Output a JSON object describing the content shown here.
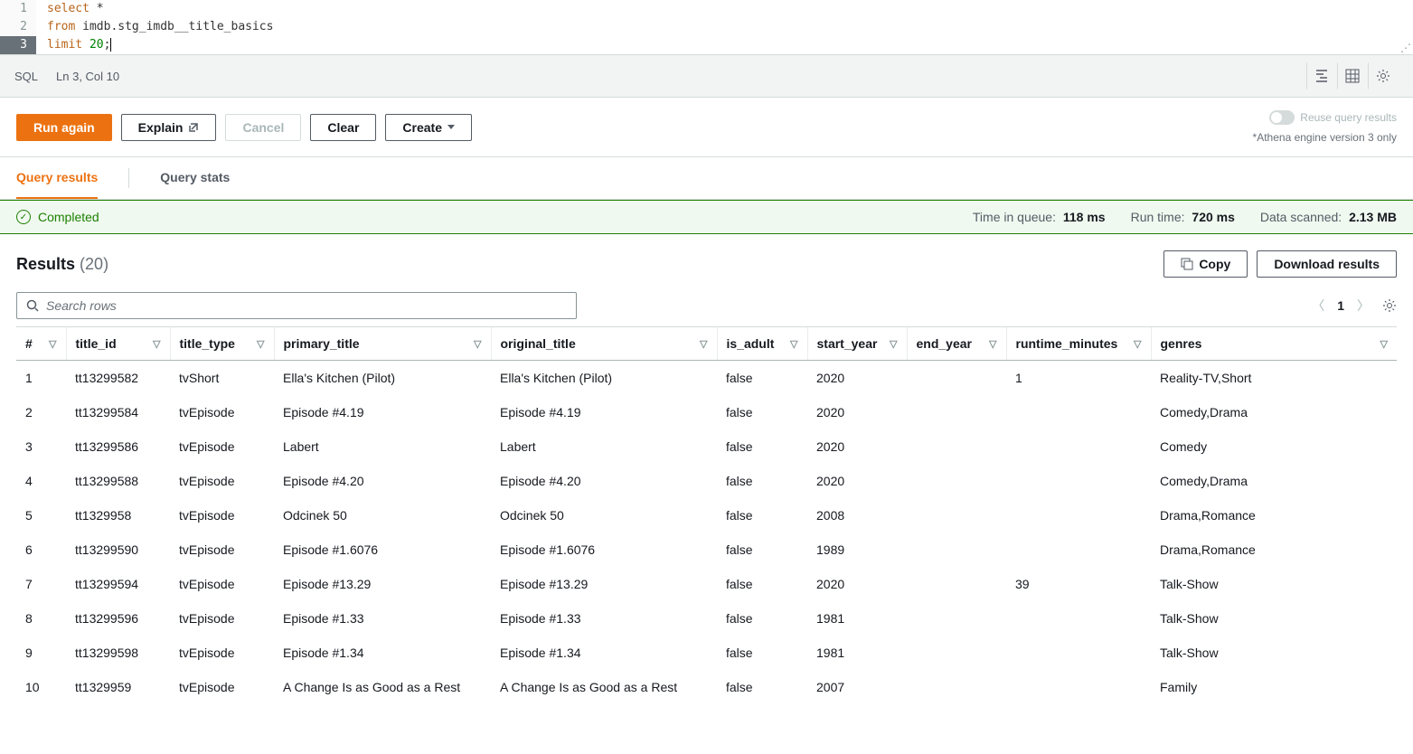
{
  "editor": {
    "lines": [
      {
        "n": 1,
        "tokens": [
          {
            "cls": "kw-select",
            "t": "select"
          },
          {
            "cls": "ident",
            "t": " *"
          }
        ]
      },
      {
        "n": 2,
        "tokens": [
          {
            "cls": "kw-from",
            "t": "from"
          },
          {
            "cls": "ident",
            "t": " imdb.stg_imdb__title_basics"
          }
        ]
      },
      {
        "n": 3,
        "tokens": [
          {
            "cls": "kw-limit",
            "t": "limit"
          },
          {
            "cls": "ident",
            "t": " "
          },
          {
            "cls": "num",
            "t": "20"
          },
          {
            "cls": "punct",
            "t": ";"
          }
        ],
        "active": true
      }
    ]
  },
  "statusbar": {
    "lang": "SQL",
    "cursor": "Ln 3, Col 10"
  },
  "toolbar": {
    "run": "Run again",
    "explain": "Explain",
    "cancel": "Cancel",
    "clear": "Clear",
    "create": "Create",
    "reuse_label": "Reuse query results",
    "engine_note": "*Athena engine version 3 only"
  },
  "tabs": {
    "results": "Query results",
    "stats": "Query stats"
  },
  "status": {
    "state": "Completed",
    "queue_label": "Time in queue:",
    "queue_val": "118 ms",
    "runtime_label": "Run time:",
    "runtime_val": "720 ms",
    "scanned_label": "Data scanned:",
    "scanned_val": "2.13 MB"
  },
  "results": {
    "title": "Results",
    "count": "(20)",
    "copy": "Copy",
    "download": "Download results",
    "search_placeholder": "Search rows",
    "page": "1"
  },
  "columns": [
    "#",
    "title_id",
    "title_type",
    "primary_title",
    "original_title",
    "is_adult",
    "start_year",
    "end_year",
    "runtime_minutes",
    "genres"
  ],
  "rows": [
    {
      "n": "1",
      "title_id": "tt13299582",
      "title_type": "tvShort",
      "primary_title": "Ella's Kitchen (Pilot)",
      "original_title": "Ella's Kitchen (Pilot)",
      "is_adult": "false",
      "start_year": "2020",
      "end_year": "",
      "runtime_minutes": "1",
      "genres": "Reality-TV,Short"
    },
    {
      "n": "2",
      "title_id": "tt13299584",
      "title_type": "tvEpisode",
      "primary_title": "Episode #4.19",
      "original_title": "Episode #4.19",
      "is_adult": "false",
      "start_year": "2020",
      "end_year": "",
      "runtime_minutes": "",
      "genres": "Comedy,Drama"
    },
    {
      "n": "3",
      "title_id": "tt13299586",
      "title_type": "tvEpisode",
      "primary_title": "Labert",
      "original_title": "Labert",
      "is_adult": "false",
      "start_year": "2020",
      "end_year": "",
      "runtime_minutes": "",
      "genres": "Comedy"
    },
    {
      "n": "4",
      "title_id": "tt13299588",
      "title_type": "tvEpisode",
      "primary_title": "Episode #4.20",
      "original_title": "Episode #4.20",
      "is_adult": "false",
      "start_year": "2020",
      "end_year": "",
      "runtime_minutes": "",
      "genres": "Comedy,Drama"
    },
    {
      "n": "5",
      "title_id": "tt1329958",
      "title_type": "tvEpisode",
      "primary_title": "Odcinek 50",
      "original_title": "Odcinek 50",
      "is_adult": "false",
      "start_year": "2008",
      "end_year": "",
      "runtime_minutes": "",
      "genres": "Drama,Romance"
    },
    {
      "n": "6",
      "title_id": "tt13299590",
      "title_type": "tvEpisode",
      "primary_title": "Episode #1.6076",
      "original_title": "Episode #1.6076",
      "is_adult": "false",
      "start_year": "1989",
      "end_year": "",
      "runtime_minutes": "",
      "genres": "Drama,Romance"
    },
    {
      "n": "7",
      "title_id": "tt13299594",
      "title_type": "tvEpisode",
      "primary_title": "Episode #13.29",
      "original_title": "Episode #13.29",
      "is_adult": "false",
      "start_year": "2020",
      "end_year": "",
      "runtime_minutes": "39",
      "genres": "Talk-Show"
    },
    {
      "n": "8",
      "title_id": "tt13299596",
      "title_type": "tvEpisode",
      "primary_title": "Episode #1.33",
      "original_title": "Episode #1.33",
      "is_adult": "false",
      "start_year": "1981",
      "end_year": "",
      "runtime_minutes": "",
      "genres": "Talk-Show"
    },
    {
      "n": "9",
      "title_id": "tt13299598",
      "title_type": "tvEpisode",
      "primary_title": "Episode #1.34",
      "original_title": "Episode #1.34",
      "is_adult": "false",
      "start_year": "1981",
      "end_year": "",
      "runtime_minutes": "",
      "genres": "Talk-Show"
    },
    {
      "n": "10",
      "title_id": "tt1329959",
      "title_type": "tvEpisode",
      "primary_title": "A Change Is as Good as a Rest",
      "original_title": "A Change Is as Good as a Rest",
      "is_adult": "false",
      "start_year": "2007",
      "end_year": "",
      "runtime_minutes": "",
      "genres": "Family"
    }
  ]
}
